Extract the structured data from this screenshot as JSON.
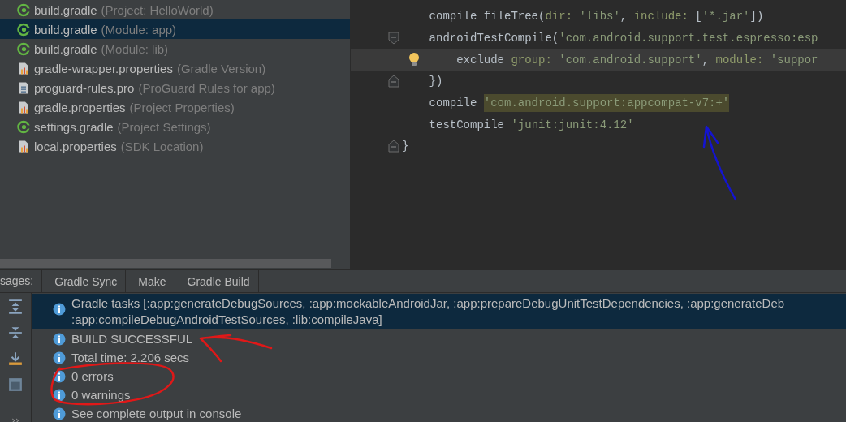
{
  "project_tree": [
    {
      "name": "build.gradle",
      "detail": "(Project: HelloWorld)",
      "kind": "gradle",
      "selected": false
    },
    {
      "name": "build.gradle",
      "detail": "(Module: app)",
      "kind": "gradle",
      "selected": true
    },
    {
      "name": "build.gradle",
      "detail": "(Module: lib)",
      "kind": "gradle",
      "selected": false
    },
    {
      "name": "gradle-wrapper.properties",
      "detail": "(Gradle Version)",
      "kind": "properties",
      "selected": false
    },
    {
      "name": "proguard-rules.pro",
      "detail": "(ProGuard Rules for app)",
      "kind": "text",
      "selected": false
    },
    {
      "name": "gradle.properties",
      "detail": "(Project Properties)",
      "kind": "properties",
      "selected": false
    },
    {
      "name": "settings.gradle",
      "detail": "(Project Settings)",
      "kind": "gradle",
      "selected": false
    },
    {
      "name": "local.properties",
      "detail": "(SDK Location)",
      "kind": "properties",
      "selected": false
    }
  ],
  "editor": {
    "lines": [
      {
        "kind": "plain",
        "current": false,
        "segments": [
          {
            "kind": "plain",
            "text": "    compile fileTree("
          },
          {
            "kind": "param",
            "text": "dir: "
          },
          {
            "kind": "string",
            "text": "'libs'"
          },
          {
            "kind": "plain",
            "text": ", "
          },
          {
            "kind": "param",
            "text": "include: "
          },
          {
            "kind": "plain",
            "text": "["
          },
          {
            "kind": "string",
            "text": "'*.jar'"
          },
          {
            "kind": "plain",
            "text": "])"
          }
        ]
      },
      {
        "kind": "fold-start",
        "current": false,
        "segments": [
          {
            "kind": "plain",
            "text": "    androidTestCompile("
          },
          {
            "kind": "string",
            "text": "'com.android.support.test.espresso:esp"
          }
        ]
      },
      {
        "kind": "bulb",
        "current": true,
        "segments": [
          {
            "kind": "plain",
            "text": "        exclude "
          },
          {
            "kind": "param",
            "text": "group: "
          },
          {
            "kind": "string",
            "text": "'com.android.support'"
          },
          {
            "kind": "plain",
            "text": ", "
          },
          {
            "kind": "param",
            "text": "module: "
          },
          {
            "kind": "string",
            "text": "'suppor"
          }
        ]
      },
      {
        "kind": "fold-end",
        "current": false,
        "segments": [
          {
            "kind": "plain",
            "text": "    })"
          }
        ]
      },
      {
        "kind": "plain",
        "current": false,
        "segments": [
          {
            "kind": "plain",
            "text": "    compile "
          },
          {
            "kind": "highlight",
            "text": "'com.android.support:appcompat-v7:+'"
          }
        ]
      },
      {
        "kind": "plain",
        "current": false,
        "segments": [
          {
            "kind": "plain",
            "text": "    testCompile "
          },
          {
            "kind": "string",
            "text": "'junit:junit:4.12'"
          }
        ]
      },
      {
        "kind": "fold-end",
        "current": false,
        "segments": [
          {
            "kind": "plain",
            "text": "}"
          }
        ]
      }
    ]
  },
  "messages": {
    "title": "sages:",
    "tabs": [
      "Gradle Sync",
      "Make",
      "Gradle Build"
    ],
    "items": [
      {
        "lines": [
          "Gradle tasks [:app:generateDebugSources, :app:mockableAndroidJar, :app:prepareDebugUnitTestDependencies, :app:generateDeb",
          ":app:compileDebugAndroidTestSources, :lib:compileJava]"
        ],
        "selected": true
      },
      {
        "lines": [
          "BUILD SUCCESSFUL"
        ],
        "selected": false
      },
      {
        "lines": [
          "Total time: 2.206 secs"
        ],
        "selected": false
      },
      {
        "lines": [
          "0 errors"
        ],
        "selected": false
      },
      {
        "lines": [
          "0 warnings"
        ],
        "selected": false
      },
      {
        "lines": [
          "See complete output in console"
        ],
        "selected": false
      }
    ],
    "toolbar_more": "››"
  }
}
